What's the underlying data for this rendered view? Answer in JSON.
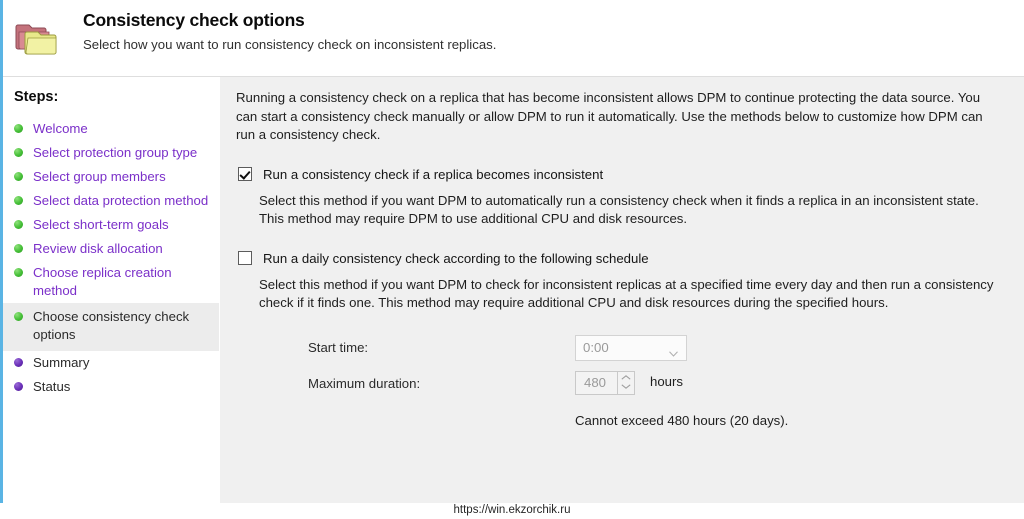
{
  "header": {
    "icon": "folder-pair-icon",
    "title": "Consistency check options",
    "subtitle": "Select how you want to run consistency check on inconsistent replicas."
  },
  "sidebar": {
    "label": "Steps:",
    "items": [
      {
        "label": "Welcome",
        "state": "done",
        "bullet": "green"
      },
      {
        "label": "Select protection group type",
        "state": "done",
        "bullet": "green"
      },
      {
        "label": "Select group members",
        "state": "done",
        "bullet": "green"
      },
      {
        "label": "Select data protection method",
        "state": "done",
        "bullet": "green"
      },
      {
        "label": "Select short-term goals",
        "state": "done",
        "bullet": "green"
      },
      {
        "label": "Review disk allocation",
        "state": "done",
        "bullet": "green"
      },
      {
        "label": "Choose replica creation method",
        "state": "done",
        "bullet": "green"
      },
      {
        "label": "Choose consistency check options",
        "state": "current",
        "bullet": "green"
      },
      {
        "label": "Summary",
        "state": "future",
        "bullet": "purple"
      },
      {
        "label": "Status",
        "state": "future",
        "bullet": "purple"
      }
    ]
  },
  "main": {
    "intro": "Running a consistency check on a replica that has become inconsistent allows DPM to continue protecting the data source. You can start a consistency check manually or allow DPM to run it automatically. Use the methods below to customize how DPM can run a consistency check.",
    "option_auto": {
      "label": "Run a consistency check if a replica becomes inconsistent",
      "checked": true,
      "description": "Select this method if you want DPM to automatically run a consistency check when it finds a replica in an inconsistent state. This method may require DPM to use additional CPU and disk resources."
    },
    "option_daily": {
      "label": "Run a daily consistency check according to the following schedule",
      "checked": false,
      "description": "Select this method if you want DPM to check for inconsistent replicas at a specified time every day and then run a consistency check if it finds one. This method may require additional CPU and disk resources during the specified hours."
    },
    "schedule": {
      "start_time_label": "Start time:",
      "start_time_value": "0:00",
      "max_duration_label": "Maximum duration:",
      "max_duration_value": "480",
      "max_duration_units": "hours",
      "note": "Cannot exceed 480 hours (20 days)."
    }
  },
  "footer": {
    "watermark": "https://win.ekzorchik.ru"
  },
  "colors": {
    "accent_stripe": "#5ab4e4",
    "step_link": "#7b30c9",
    "bullet_done": "#45bf37",
    "bullet_future": "#6a2fb8",
    "panel_bg": "#f0f0f0",
    "current_step_bg": "#ececec"
  }
}
